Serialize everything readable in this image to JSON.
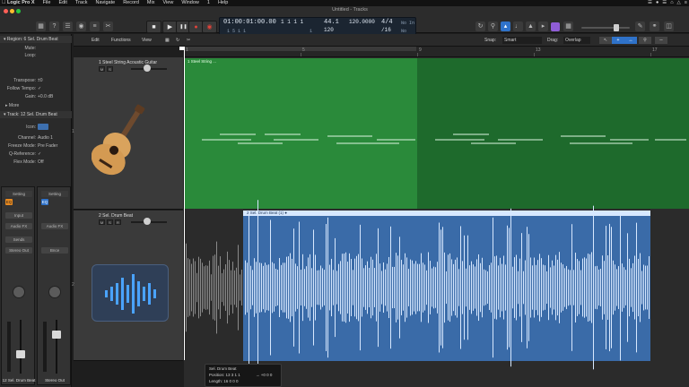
{
  "menubar": {
    "items": [
      "Logic Pro X",
      "File",
      "Edit",
      "Track",
      "Navigate",
      "Record",
      "Mix",
      "View",
      "Window",
      "1",
      "Help"
    ],
    "status": [
      "☰",
      "●",
      "☰",
      "⌂",
      "△",
      "≡"
    ]
  },
  "window": {
    "title": "Untitled - Tracks"
  },
  "transport": {
    "buttons": [
      "■",
      "▶",
      "❚❚",
      "●",
      "◉"
    ]
  },
  "lcd": {
    "time": "01:00:01:00.00",
    "time_sub": "1   5   1   1",
    "bars": "1   1   1   1",
    "bars_sub": "1",
    "bpm": "44.1",
    "tempo": "120.0000",
    "tempo_main": "120",
    "signature": "4/4",
    "division": "/16",
    "key": "No In",
    "key2": "No Out"
  },
  "toolbar": {
    "edit": "Edit",
    "functions": "Functions",
    "view": "View",
    "snap_label": "Snap:",
    "snap_value": "Smart",
    "drag_label": "Drag:",
    "drag_value": "Overlap"
  },
  "inspector": {
    "region_header": "▾ Region: 6 Sel. Drum Beat",
    "mute_label": "Mute:",
    "loop_label": "Loop:",
    "transpose_label": "Transpose:",
    "transpose_value": "±0",
    "velocity_label": "Follow Tempo:",
    "velocity_value": "✓",
    "gain_label": "Gain:",
    "gain_value": "+0.0 dB",
    "more_label": "▸ More",
    "track_header": "▾ Track: 12 Sel. Drum Beat",
    "icon_label": "Icon:",
    "channel_label": "Channel:",
    "channel_value": "Audio 1",
    "freeze_label": "Freeze Mode:",
    "freeze_value": "Pre Fader",
    "q_label": "Q-Reference:",
    "q_value": "✓",
    "flex_label": "Flex Mode:",
    "flex_value": "Off"
  },
  "strips": [
    {
      "name": "12 Sel. Drum Beat",
      "buttons": [
        "Setting",
        "EQ",
        "Input",
        "Audio FX",
        "Sends"
      ],
      "output": "Stereo Out",
      "value": "0.0"
    },
    {
      "name": "Stereo Out",
      "buttons": [
        "Setting",
        "EQ",
        "",
        "Audio FX",
        ""
      ],
      "output": "Bnce",
      "value": "0.0"
    }
  ],
  "tracks": [
    {
      "number": "1",
      "title": "1 Steel String Acoustic Guitar"
    },
    {
      "number": "2",
      "title": "2 Sel. Drum Beat"
    }
  ],
  "regions": {
    "midi": "1 Steel String ...",
    "audio": "2 Sel. Drum Beat (1) ●"
  },
  "ruler": [
    "1",
    "5",
    "9",
    "13",
    "17"
  ],
  "info": {
    "line1": "Sel. Drum Beat",
    "line2": "Position: 13 3 1 1",
    "line3": "Length: 16 0 0 0",
    "line4": "→ +0 0 0"
  },
  "colors": {
    "midi_region": "#2a8a3a",
    "audio_region": "#3a6ba8",
    "waveform": "#d7e8ff"
  }
}
